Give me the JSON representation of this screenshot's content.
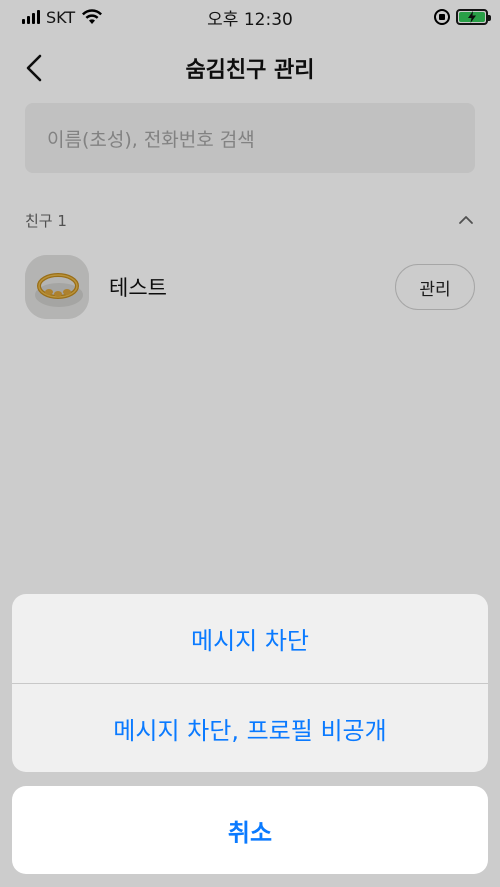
{
  "status_bar": {
    "carrier": "SKT",
    "time": "오후 12:30"
  },
  "header": {
    "title": "숨김친구 관리",
    "back_icon": "chevron-left-icon"
  },
  "search": {
    "placeholder": "이름(초성), 전화번호 검색"
  },
  "section": {
    "label": "친구 1",
    "collapse_icon": "chevron-up-icon"
  },
  "friends": [
    {
      "name": "테스트",
      "action_label": "관리",
      "avatar": "gold-ring-photo"
    }
  ],
  "action_sheet": {
    "options": [
      "메시지 차단",
      "메시지 차단, 프로필 비공개"
    ],
    "cancel_label": "취소",
    "accent_color": "#0a7aff"
  }
}
